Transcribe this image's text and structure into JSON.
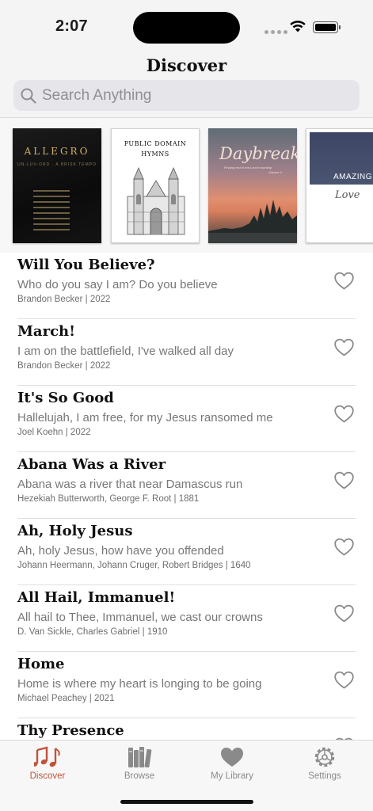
{
  "status_bar": {
    "time": "2:07"
  },
  "header": {
    "title": "Discover"
  },
  "search": {
    "placeholder": "Search Anything"
  },
  "featured": [
    {
      "title": "ALLEGRO",
      "subtitle": "UN-LUV-ORD · A BRISK TEMPO",
      "style": "dark-gold"
    },
    {
      "title_line1": "Public Domain",
      "title_line2": "Hymns",
      "style": "white-cathedral"
    },
    {
      "title": "Daybreak",
      "subtitle": "Finding rest in the Lord in worship",
      "volume": "Volume II",
      "style": "sunset"
    },
    {
      "title": "AMAZING",
      "subtitle": "Love",
      "style": "navy-white"
    }
  ],
  "songs": [
    {
      "title": "Will You Believe?",
      "lyric": "Who do you say I am? Do you believe",
      "meta": "Brandon Becker | 2022"
    },
    {
      "title": "March!",
      "lyric": "I am on the battlefield, I've walked all day",
      "meta": "Brandon Becker | 2022"
    },
    {
      "title": "It's So Good",
      "lyric": "Hallelujah, I am free, for my Jesus ransomed me",
      "meta": "Joel Koehn | 2022"
    },
    {
      "title": "Abana Was a River",
      "lyric": "Abana was a river that near Damascus run",
      "meta": "Hezekiah Butterworth, George F. Root | 1881"
    },
    {
      "title": "Ah, Holy Jesus",
      "lyric": "Ah, holy Jesus, how have you offended",
      "meta": "Johann Heermann, Johann Cruger, Robert Bridges | 1640"
    },
    {
      "title": "All Hail, Immanuel!",
      "lyric": "All hail to Thee, Immanuel, we cast our crowns",
      "meta": "D. Van Sickle, Charles Gabriel | 1910"
    },
    {
      "title": "Home",
      "lyric": "Home is where my heart is longing to be going",
      "meta": "Michael Peachey | 2021"
    },
    {
      "title": "Thy Presence",
      "lyric": "",
      "meta": ""
    }
  ],
  "tabs": [
    {
      "label": "Discover",
      "icon": "music-notes-icon",
      "active": true
    },
    {
      "label": "Browse",
      "icon": "books-icon",
      "active": false
    },
    {
      "label": "My Library",
      "icon": "heart-icon",
      "active": false
    },
    {
      "label": "Settings",
      "icon": "gear-icon",
      "active": false
    }
  ],
  "colors": {
    "accent": "#c0533a",
    "inactive_tab": "#8a8a8a",
    "search_bg": "#e6e6ea"
  }
}
